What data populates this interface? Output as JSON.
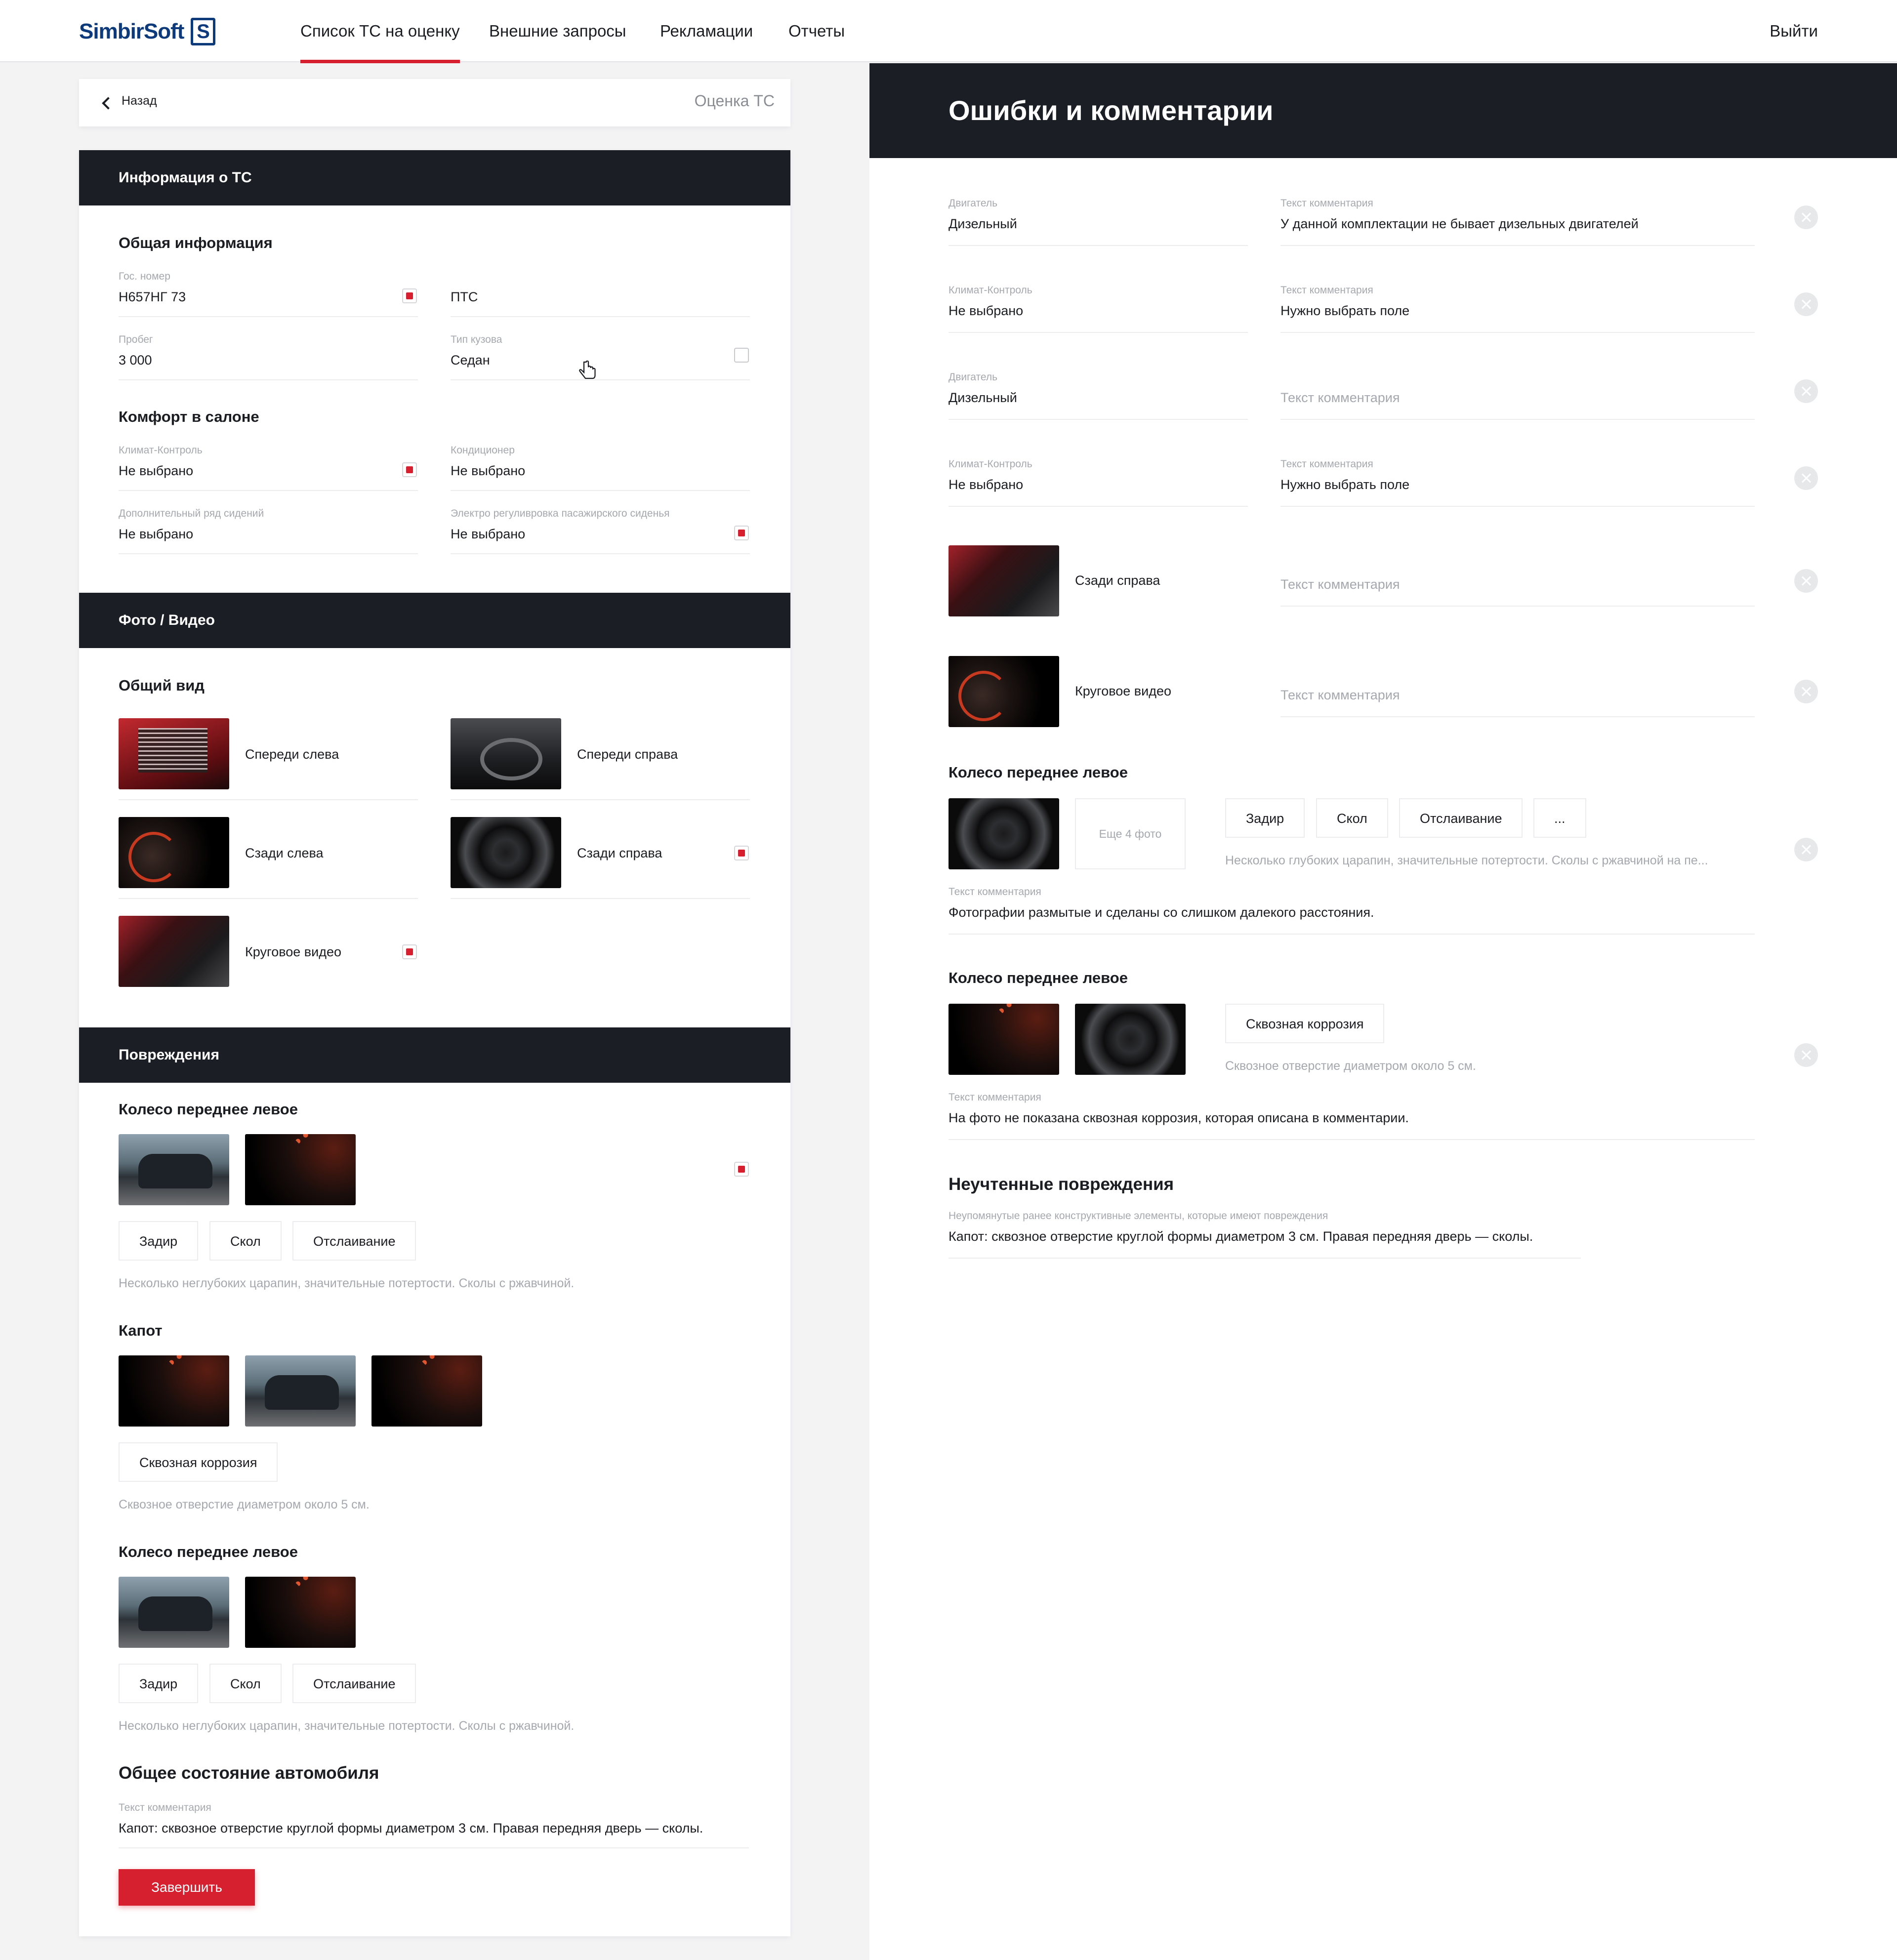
{
  "header": {
    "logo_text": "SimbirSoft",
    "logo_mark": "S",
    "nav": [
      "Список ТС на оценку",
      "Внешние запросы",
      "Рекламации",
      "Отчеты"
    ],
    "logout": "Выйти",
    "accent_color": "#d61f2f",
    "brand_color": "#0d3a7a"
  },
  "back_bar": {
    "back_label": "Назад",
    "title": "Оценка ТС"
  },
  "left": {
    "info_header": "Информация о ТС",
    "general_title": "Общая информация",
    "gos_nomer": {
      "label": "Гос. номер",
      "value": "Н657НГ 73"
    },
    "pts": {
      "value": "ПТС"
    },
    "probeg": {
      "label": "Пробег",
      "value": "3 000"
    },
    "body_type": {
      "label": "Тип кузова",
      "value": "Седан"
    },
    "comfort_title": "Комфорт в салоне",
    "climate": {
      "label": "Климат-Контроль",
      "value": "Не выбрано"
    },
    "conditioner": {
      "label": "Кондиционер",
      "value": "Не выбрано"
    },
    "extra_seats": {
      "label": "Дополнительный ряд сидений",
      "value": "Не выбрано"
    },
    "electro_seat": {
      "label": "Электро регуливровка пасажирского сиденья",
      "value": "Не выбрано"
    },
    "photo_header": "Фото / Видео",
    "overview_title": "Общий вид",
    "photos": [
      "Спереди слева",
      "Спереди справа",
      "Сзади слева",
      "Сзади справа",
      "Круговое видео"
    ],
    "damage_header": "Повреждения",
    "damage1": {
      "title": "Колесо переднее левое",
      "chips": [
        "Задир",
        "Скол",
        "Отслаивание"
      ],
      "desc": "Несколько неглубоких царапин, значительные потертости. Сколы с ржавчиной."
    },
    "damage2": {
      "title": "Капот",
      "chips": [
        "Сквозная коррозия"
      ],
      "desc": "Сквозное отверстие диаметром около 5 см."
    },
    "damage3": {
      "title": "Колесо переднее левое",
      "chips": [
        "Задир",
        "Скол",
        "Отслаивание"
      ],
      "desc": "Несколько неглубоких царапин, значительные потертости. Сколы с ржавчиной."
    },
    "overall_title": "Общее состояние автомобиля",
    "overall_comment": {
      "label": "Текст комментария",
      "value": "Капот: сквозное отверстие круглой формы диаметром 3 см. Правая передняя дверь — сколы."
    },
    "finish_button": "Завершить"
  },
  "right": {
    "title": "Ошибки и комментарии",
    "rows": [
      {
        "label": "Двигатель",
        "value": "Дизельный",
        "comment_label": "Текст комментария",
        "comment": "У данной комплектации не бывает дизельных двигателей"
      },
      {
        "label": "Климат-Контроль",
        "value": "Не выбрано",
        "comment_label": "Текст комментария",
        "comment": "Нужно выбрать поле"
      },
      {
        "label": "Двигатель",
        "value": "Дизельный",
        "comment_placeholder": "Текст комментария"
      },
      {
        "label": "Климат-Контроль",
        "value": "Не выбрано",
        "comment_label": "Текст комментария",
        "comment": "Нужно выбрать поле"
      }
    ],
    "photo_rows": [
      {
        "label": "Сзади справа",
        "comment_placeholder": "Текст комментария"
      },
      {
        "label": "Круговое видео",
        "comment_placeholder": "Текст комментария"
      }
    ],
    "damage1": {
      "title": "Колесо переднее левое",
      "more_photos": "Еще 4 фото",
      "chips": [
        "Задир",
        "Скол",
        "Отслаивание",
        "..."
      ],
      "desc": "Несколько глубоких царапин, значительные потертости. Сколы с ржавчиной на пе...",
      "comment_label": "Текст комментария",
      "comment": "Фотографии размытые и сделаны со слишком далекого расстояния."
    },
    "damage2": {
      "title": "Колесо переднее левое",
      "chips": [
        "Сквозная коррозия"
      ],
      "desc": "Сквозное отверстие диаметром около 5 см.",
      "comment_label": "Текст комментария",
      "comment": "На фото не показана сквозная коррозия, которая описана в комментарии."
    },
    "unaccounted": {
      "title": "Неучтенные повреждения",
      "label": "Неупомянутые ранее конструктивные элементы, которые имеют повреждения",
      "value": "Капот: сквозное отверстие круглой формы диаметром 3 см. Правая передняя дверь — сколы."
    }
  }
}
